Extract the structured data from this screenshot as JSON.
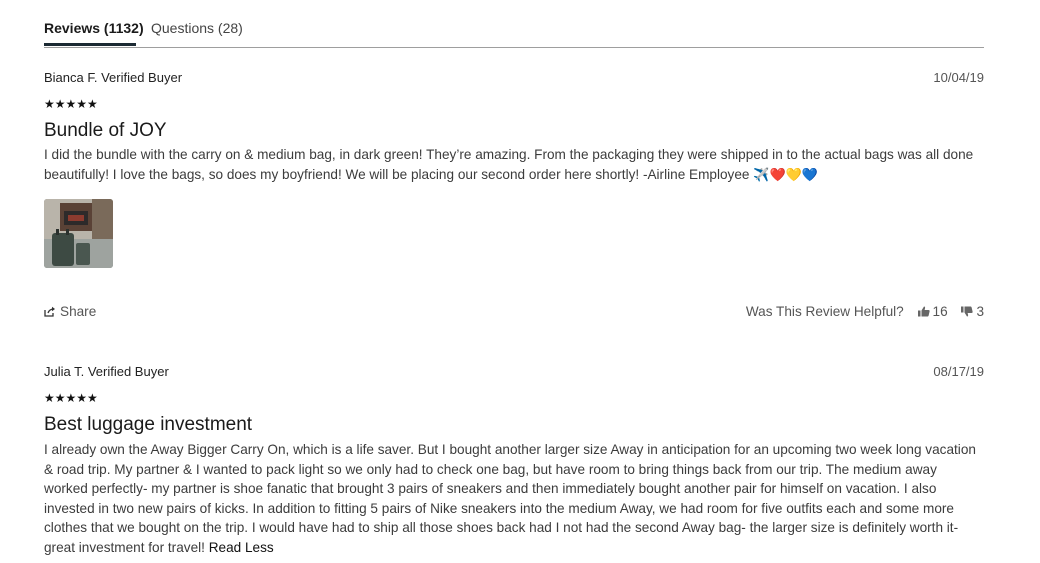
{
  "tabs": [
    {
      "label": "Reviews (1132)",
      "active": true
    },
    {
      "label": "Questions (28)",
      "active": false
    }
  ],
  "reviews": [
    {
      "author": "Bianca F. Verified Buyer",
      "date": "10/04/19",
      "rating": 5,
      "stars_text": "★★★★★",
      "title": "Bundle of JOY",
      "body": "I did the bundle with the carry on & medium bag, in dark green! They’re amazing. From the packaging they were shipped in to the actual bags was all done beautifully! I love the bags, so does my boyfriend! We will be placing our second order here shortly! -Airline Employee ",
      "emoji": "✈️❤️💛💙",
      "has_photo": true,
      "share_label": "Share",
      "helpful_label": "Was This Review Helpful?",
      "helpful_up": "16",
      "helpful_down": "3"
    },
    {
      "author": "Julia T. Verified Buyer",
      "date": "08/17/19",
      "rating": 5,
      "stars_text": "★★★★★",
      "title": "Best luggage investment",
      "body": "I already own the Away Bigger Carry On, which is a life saver. But I bought another larger size Away in anticipation for an upcoming two week long vacation & road trip. My partner & I wanted to pack light so we only had to check one bag, but have room to bring things back from our trip. The medium away worked perfectly- my partner is shoe fanatic that brought 3 pairs of sneakers and then immediately bought another pair for himself on vacation. I also invested in two new pairs of kicks. In addition to fitting 5 pairs of Nike sneakers into the medium Away, we had room for five outfits each and some more clothes that we bought on the trip. I would have had to ship all those shoes back had I not had the second Away bag- the larger size is definitely worth it- great investment for travel! ",
      "read_less_label": "Read Less"
    }
  ],
  "icons": {
    "share": "share-icon",
    "thumbs_up": "thumbs-up-icon",
    "thumbs_down": "thumbs-down-icon"
  }
}
